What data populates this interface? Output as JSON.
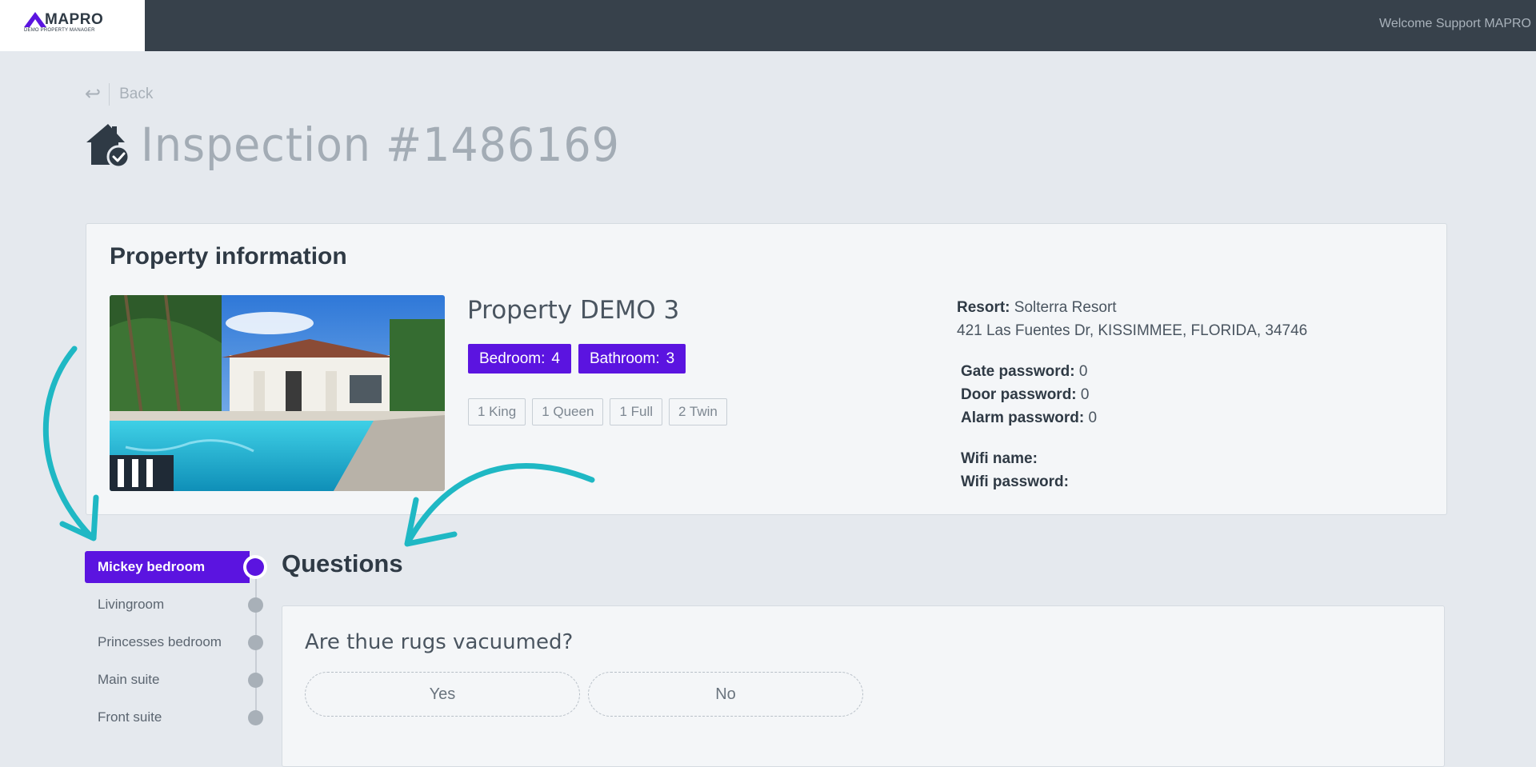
{
  "header": {
    "logo_name": "MAPRO",
    "logo_tagline": "DEMO PROPERTY MANAGER",
    "welcome": "Welcome Support MAPRO"
  },
  "nav": {
    "back_label": "Back"
  },
  "page": {
    "title": "Inspection #1486169"
  },
  "property_card": {
    "title": "Property information",
    "name": "Property DEMO 3",
    "badges": [
      {
        "label": "Bedroom:",
        "value": "4"
      },
      {
        "label": "Bathroom:",
        "value": "3"
      }
    ],
    "beds": [
      "1 King",
      "1 Queen",
      "1 Full",
      "2 Twin"
    ],
    "resort_label": "Resort:",
    "resort_value": "Solterra Resort",
    "address": "421 Las Fuentes Dr, KISSIMMEE, FLORIDA, 34746",
    "gate_label": "Gate password:",
    "gate_value": "0",
    "door_label": "Door password:",
    "door_value": "0",
    "alarm_label": "Alarm password:",
    "alarm_value": "0",
    "wifi_name_label": "Wifi name:",
    "wifi_name_value": "",
    "wifi_password_label": "Wifi password:",
    "wifi_password_value": ""
  },
  "rooms": [
    {
      "label": "Mickey bedroom",
      "active": true
    },
    {
      "label": "Livingroom",
      "active": false
    },
    {
      "label": "Princesses bedroom",
      "active": false
    },
    {
      "label": "Main suite",
      "active": false
    },
    {
      "label": "Front suite",
      "active": false
    }
  ],
  "questions": {
    "title": "Questions",
    "items": [
      {
        "text": "Are thue rugs vacuumed?",
        "options": [
          "Yes",
          "No"
        ]
      }
    ]
  },
  "colors": {
    "accent": "#5b14e0",
    "topbar": "#37414b",
    "annotation": "#1fb8c4"
  }
}
